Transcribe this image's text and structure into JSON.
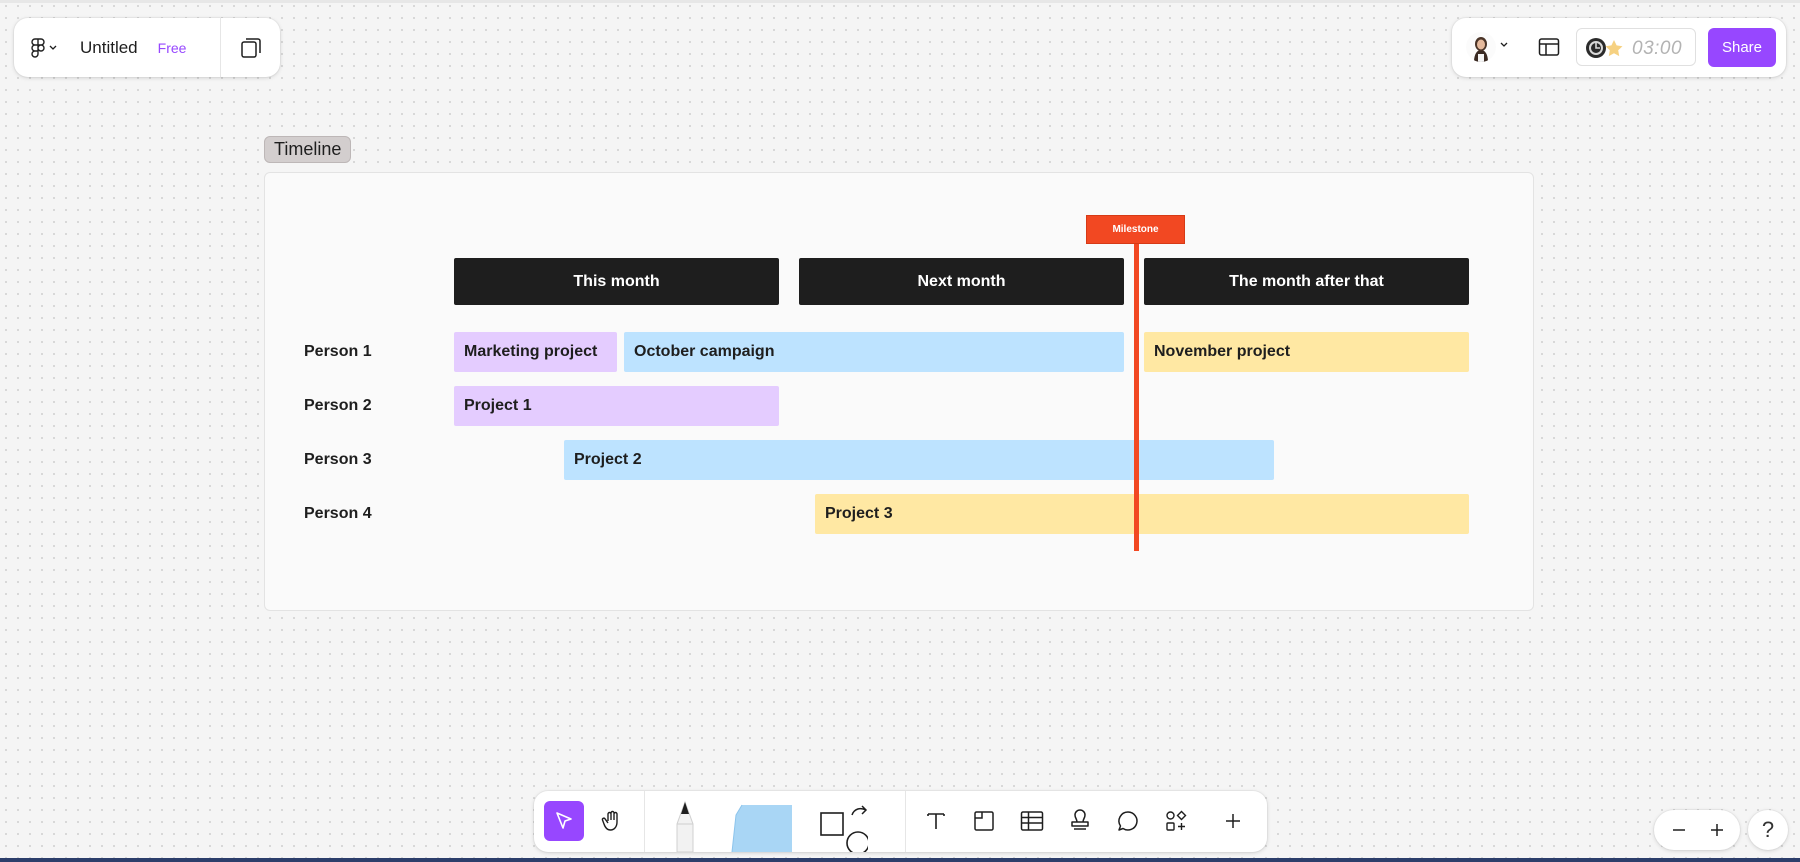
{
  "file": {
    "title": "Untitled",
    "plan": "Free"
  },
  "header": {
    "timer": "03:00",
    "share_label": "Share"
  },
  "section": {
    "label": "Timeline"
  },
  "timeline": {
    "months": [
      "This month",
      "Next month",
      "The month after that"
    ],
    "people": [
      "Person 1",
      "Person 2",
      "Person 3",
      "Person 4"
    ],
    "bars": [
      {
        "label": "Marketing project",
        "color": "#e4ccff"
      },
      {
        "label": "October campaign",
        "color": "#bde3ff"
      },
      {
        "label": "November project",
        "color": "#ffe8a3"
      },
      {
        "label": "Project 1",
        "color": "#e4ccff"
      },
      {
        "label": "Project 2",
        "color": "#bde3ff"
      },
      {
        "label": "Project 3",
        "color": "#ffe8a3"
      }
    ],
    "milestone": "Milestone",
    "milestone_color": "#f24822"
  },
  "toolbar": {
    "tools": [
      "cursor-icon",
      "hand-icon",
      "pen-icon",
      "sticky-note-icon",
      "shape-icon",
      "text-icon",
      "section-icon",
      "table-icon",
      "stamp-icon",
      "comment-icon",
      "widgets-icon",
      "plus-icon"
    ]
  },
  "zoom": {
    "help": "?"
  },
  "colors": {
    "accent": "#9747ff"
  }
}
